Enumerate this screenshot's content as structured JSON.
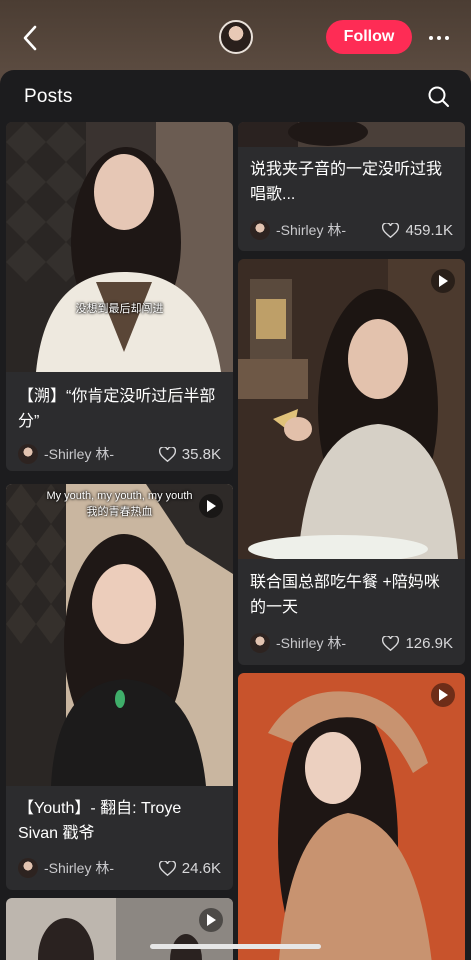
{
  "header": {
    "follow_label": "Follow"
  },
  "panel": {
    "title": "Posts"
  },
  "posts": [
    {
      "title": "【溯】“你肯定没听过后半部分”",
      "overlay": "没想到最后却闯进",
      "author": "-Shirley 林-",
      "likes": "35.8K"
    },
    {
      "title": "【Youth】- 翻自: Troye Sivan 戳爷",
      "overlay_line1": "My youth, my youth, my youth",
      "overlay_line2": "我的青春热血",
      "author": "-Shirley 林-",
      "likes": "24.6K"
    },
    {
      "title": "说我夹子音的一定没听过我唱歌...",
      "author": "-Shirley 林-",
      "likes": "459.1K"
    },
    {
      "title": "联合国总部吃午餐 +陪妈咪的一天",
      "author": "-Shirley 林-",
      "likes": "126.9K"
    }
  ],
  "colors": {
    "follow": "#fe2c55",
    "panel": "#1c1c1e",
    "card": "#2c2c2e"
  }
}
